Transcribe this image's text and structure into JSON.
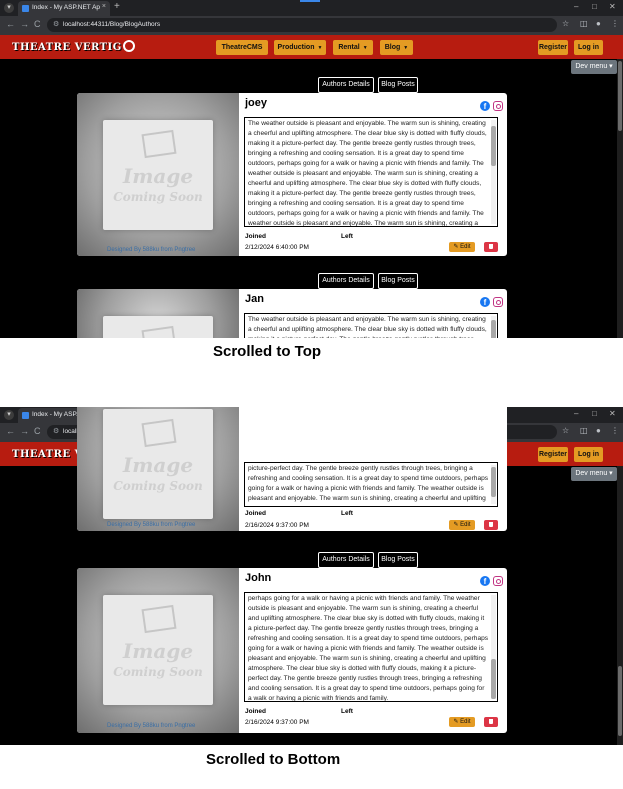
{
  "browser": {
    "tab_title": "Index - My ASP.NET Application",
    "tab_close": "×",
    "new_tab": "+",
    "url": "localhost:44311/Blog/BlogAuthors",
    "nav_back": "←",
    "nav_forward": "→",
    "nav_reload": "C"
  },
  "site": {
    "brand": "THEATRE VERTIG",
    "nav": {
      "theatrecms": "TheatreCMS",
      "production": "Production",
      "rental": "Rental",
      "blog": "Blog",
      "register": "Register",
      "login": "Log in"
    },
    "dev_menu": "Dev menu"
  },
  "tabs": {
    "authors_details": "Authors Details",
    "blog_posts": "Blog Posts"
  },
  "placeholder_image": {
    "line1": "Image",
    "line2": "Coming Soon",
    "credit": "Designed By 588ku from Pngtree"
  },
  "labels": {
    "joined": "Joined",
    "left": "Left",
    "edit": "Edit"
  },
  "top_view": {
    "caption": "Scrolled to Top",
    "card1": {
      "name": "joey",
      "joined_date": "2/12/2024 6:40:00 PM",
      "bio": "The weather outside is pleasant and enjoyable. The warm sun is shining, creating a cheerful and uplifting atmosphere. The clear blue sky is dotted with fluffy clouds, making it a picture-perfect day. The gentle breeze gently rustles through trees, bringing a refreshing and cooling sensation. It is a great day to spend time outdoors, perhaps going for a walk or having a picnic with friends and family. The weather outside is pleasant and enjoyable. The warm sun is shining, creating a cheerful and uplifting atmosphere. The clear blue sky is dotted with fluffy clouds, making it a picture-perfect day. The gentle breeze gently rustles through trees, bringing a refreshing and cooling sensation. It is a great day to spend time outdoors, perhaps going for a walk or having a picnic with friends and family. The weather outside is pleasant and enjoyable. The warm sun is shining, creating a cheerful and uplifting"
    },
    "card2": {
      "name": "Jan",
      "bio": "The weather outside is pleasant and enjoyable. The warm sun is shining, creating a cheerful and uplifting atmosphere. The clear blue sky is dotted with fluffy clouds, making it a picture-perfect day. The gentle breeze gently rustles through trees"
    }
  },
  "bottom_view": {
    "caption": "Scrolled to Bottom",
    "card1": {
      "joined_date": "2/16/2024 9:37:00 PM",
      "bio": "picture-perfect day. The gentle breeze gently rustles through trees, bringing a refreshing and cooling sensation. It is a great day to spend time outdoors, perhaps going for a walk or having a picnic with friends and family. The weather outside is pleasant and enjoyable. The warm sun is shining, creating a cheerful and uplifting"
    },
    "card2": {
      "name": "John",
      "joined_date": "2/16/2024 9:37:00 PM",
      "bio": "perhaps going for a walk or having a picnic with friends and family. The weather outside is pleasant and enjoyable. The warm sun is shining, creating a cheerful and uplifting atmosphere. The clear blue sky is dotted with fluffy clouds, making it a picture-perfect day. The gentle breeze gently rustles through trees, bringing a refreshing and cooling sensation. It is a great day to spend time outdoors, perhaps going for a walk or having a picnic with friends and family. The weather outside is pleasant and enjoyable. The warm sun is shining, creating a cheerful and uplifting atmosphere. The clear blue sky is dotted with fluffy clouds, making it a picture-perfect day. The gentle breeze gently rustles through trees, bringing a refreshing and cooling sensation. It is a great day to spend time outdoors, perhaps going for a walk or having a picnic with friends and family."
    }
  },
  "colors": {
    "navbar": "#b71c10",
    "accent_button": "#e49b23",
    "delete_button": "#dc3545",
    "page_background": "#000000"
  }
}
